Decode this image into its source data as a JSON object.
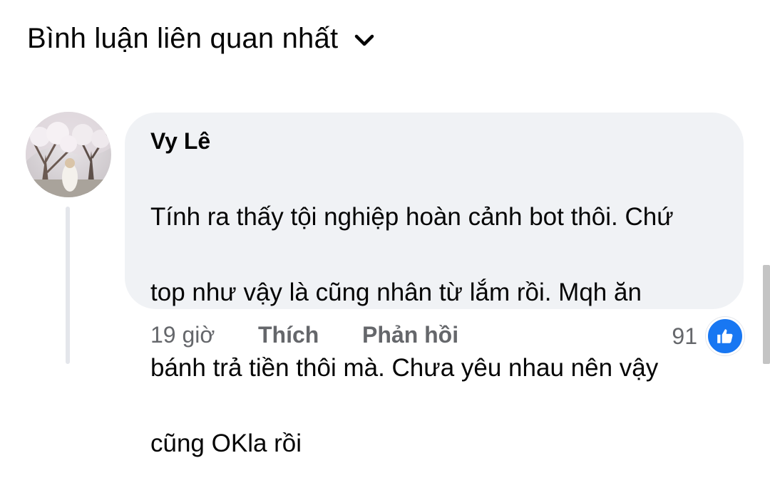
{
  "header": {
    "sort_label": "Bình luận liên quan nhất",
    "sort_icon": "chevron-down-icon"
  },
  "comment": {
    "author": "Vy Lê",
    "lines": [
      "Tính ra thấy tội nghiệp hoàn cảnh bot thôi. Chứ",
      "top như vậy là cũng nhân từ lắm rồi. Mqh ăn",
      "bánh trả tiền thôi mà. Chưa yêu nhau nên vậy",
      "cũng OKla rồi"
    ],
    "time": "19 giờ",
    "like_label": "Thích",
    "reply_label": "Phản hồi",
    "reaction_count": "91",
    "reaction_icon": "thumbs-up-icon"
  },
  "colors": {
    "bubble": "#f0f2f5",
    "secondary_text": "#65676b",
    "like_blue": "#1877f2"
  }
}
